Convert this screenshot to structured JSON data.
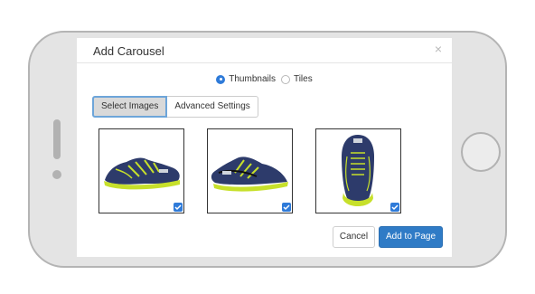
{
  "modal": {
    "title": "Add Carousel",
    "close_glyph": "×"
  },
  "layout_options": {
    "selected": "Thumbnails",
    "items": [
      {
        "label": "Thumbnails",
        "checked": true
      },
      {
        "label": "Tiles",
        "checked": false
      }
    ]
  },
  "tabs": [
    {
      "label": "Select Images",
      "active": true
    },
    {
      "label": "Advanced Settings",
      "active": false
    }
  ],
  "images": [
    {
      "view": "side",
      "selected": true
    },
    {
      "view": "side",
      "selected": true
    },
    {
      "view": "front",
      "selected": true
    }
  ],
  "footer": {
    "cancel_label": "Cancel",
    "add_label": "Add to Page"
  },
  "colors": {
    "accent": "#2f7bd9",
    "primary_button": "#2f7bc6",
    "shoe_body": "#2d3b6b",
    "shoe_accent": "#c7e02b"
  }
}
